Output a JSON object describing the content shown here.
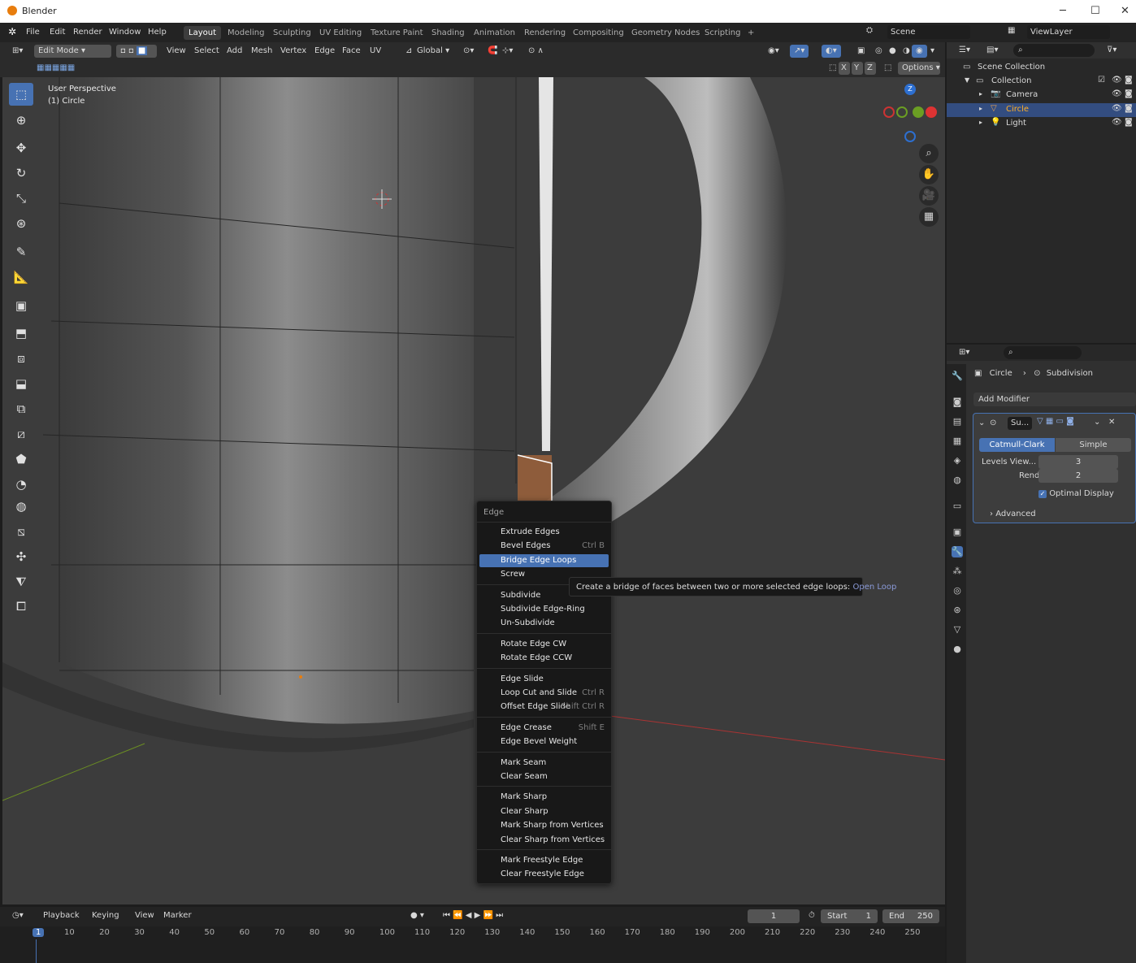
{
  "window": {
    "title": "Blender"
  },
  "menubar": {
    "menus": [
      "File",
      "Edit",
      "Render",
      "Window",
      "Help"
    ],
    "workspaces": [
      "Layout",
      "Modeling",
      "Sculpting",
      "UV Editing",
      "Texture Paint",
      "Shading",
      "Animation",
      "Rendering",
      "Compositing",
      "Geometry Nodes",
      "Scripting"
    ],
    "active_workspace": "Layout",
    "add_tab": "+",
    "scene": "Scene",
    "view_layer": "ViewLayer"
  },
  "viewport_header": {
    "mode": "Edit Mode",
    "menus": [
      "View",
      "Select",
      "Add",
      "Mesh",
      "Vertex",
      "Edge",
      "Face",
      "UV"
    ],
    "transform_orientation": "Global",
    "axes": [
      "X",
      "Y",
      "Z"
    ],
    "options": "Options"
  },
  "viewport": {
    "view_name": "User Perspective",
    "object_name": "(1) Circle",
    "gizmo_axis_z": "Z"
  },
  "context_menu": {
    "title": "Edge",
    "groups": [
      [
        {
          "label": "Extrude Edges",
          "shortcut": ""
        },
        {
          "label": "Bevel Edges",
          "shortcut": "Ctrl B"
        },
        {
          "label": "Bridge Edge Loops",
          "shortcut": "",
          "highlight": true
        },
        {
          "label": "Screw",
          "shortcut": ""
        }
      ],
      [
        {
          "label": "Subdivide",
          "shortcut": ""
        },
        {
          "label": "Subdivide Edge-Ring",
          "shortcut": ""
        },
        {
          "label": "Un-Subdivide",
          "shortcut": ""
        }
      ],
      [
        {
          "label": "Rotate Edge CW",
          "shortcut": ""
        },
        {
          "label": "Rotate Edge CCW",
          "shortcut": ""
        }
      ],
      [
        {
          "label": "Edge Slide",
          "shortcut": ""
        },
        {
          "label": "Loop Cut and Slide",
          "shortcut": "Ctrl R"
        },
        {
          "label": "Offset Edge Slide",
          "shortcut": "Shift Ctrl R"
        }
      ],
      [
        {
          "label": "Edge Crease",
          "shortcut": "Shift E"
        },
        {
          "label": "Edge Bevel Weight",
          "shortcut": ""
        }
      ],
      [
        {
          "label": "Mark Seam",
          "shortcut": ""
        },
        {
          "label": "Clear Seam",
          "shortcut": ""
        }
      ],
      [
        {
          "label": "Mark Sharp",
          "shortcut": ""
        },
        {
          "label": "Clear Sharp",
          "shortcut": ""
        },
        {
          "label": "Mark Sharp from Vertices",
          "shortcut": ""
        },
        {
          "label": "Clear Sharp from Vertices",
          "shortcut": ""
        }
      ],
      [
        {
          "label": "Mark Freestyle Edge",
          "shortcut": ""
        },
        {
          "label": "Clear Freestyle Edge",
          "shortcut": ""
        }
      ]
    ]
  },
  "tooltip": {
    "text": "Create a bridge of faces between two or more selected edge loops:",
    "python": "Open Loop"
  },
  "outliner": {
    "root": "Scene Collection",
    "collection": "Collection",
    "objects": [
      {
        "name": "Camera",
        "selected": false
      },
      {
        "name": "Circle",
        "selected": true
      },
      {
        "name": "Light",
        "selected": false
      }
    ]
  },
  "properties": {
    "breadcrumb_object": "Circle",
    "breadcrumb_modifier": "Subdivision",
    "add_modifier": "Add Modifier",
    "modifier_short_name": "Su...",
    "algorithms": [
      "Catmull-Clark",
      "Simple"
    ],
    "active_algorithm": "Catmull-Clark",
    "levels_viewport_label": "Levels View...",
    "levels_viewport_value": "3",
    "render_label": "Render",
    "render_value": "2",
    "optimal_display": "Optimal Display",
    "advanced": "Advanced"
  },
  "timeline": {
    "menus": [
      "Playback",
      "Keying",
      "View",
      "Marker"
    ],
    "current_frame": "1",
    "start_label": "Start",
    "start_value": "1",
    "end_label": "End",
    "end_value": "250",
    "ticks": [
      "1",
      "10",
      "20",
      "30",
      "40",
      "50",
      "60",
      "70",
      "80",
      "90",
      "100",
      "110",
      "120",
      "130",
      "140",
      "150",
      "160",
      "170",
      "180",
      "190",
      "200",
      "210",
      "220",
      "230",
      "240",
      "250"
    ]
  },
  "colors": {
    "accent": "#4772b3",
    "selected_row": "#334d80",
    "selection_orange": "#e87d0d"
  }
}
